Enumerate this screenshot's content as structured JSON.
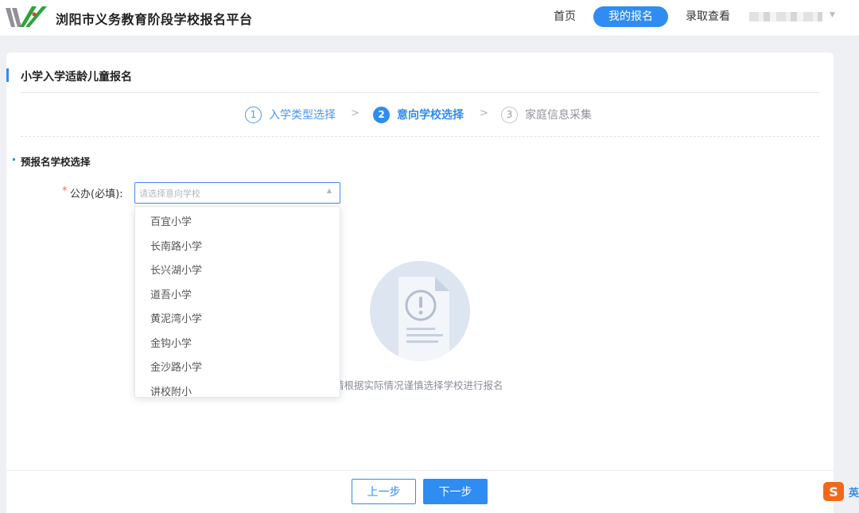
{
  "header": {
    "site_title": "浏阳市义务教育阶段学校报名平台",
    "nav": {
      "home": "首页",
      "my_registration": "我的报名",
      "admission": "录取查看"
    }
  },
  "page": {
    "title": "小学入学适龄儿童报名"
  },
  "steps": [
    {
      "number": "1",
      "label": "入学类型选择",
      "status": "done"
    },
    {
      "number": "2",
      "label": "意向学校选择",
      "status": "active"
    },
    {
      "number": "3",
      "label": "家庭信息采集",
      "status": "pending"
    }
  ],
  "section": {
    "title": "预报名学校选择"
  },
  "form": {
    "required_mark": "*",
    "field_label": "公办(必填):",
    "select_placeholder": "请选择意向学校"
  },
  "dropdown": {
    "options": [
      "百宜小学",
      "长南路小学",
      "长兴湖小学",
      "道吾小学",
      "黄泥湾小学",
      "金钩小学",
      "金沙路小学",
      "讲校附小"
    ]
  },
  "empty_state": {
    "text": "请根据实际情况谨慎选择学校进行报名"
  },
  "buttons": {
    "prev": "上一步",
    "next": "下一步"
  },
  "ime": {
    "logo": "S",
    "mode": "英"
  },
  "colors": {
    "accent": "#2f8cf1",
    "required": "#f56c6c",
    "logo_green": "#2aa53a",
    "logo_gray": "#8f9296"
  }
}
